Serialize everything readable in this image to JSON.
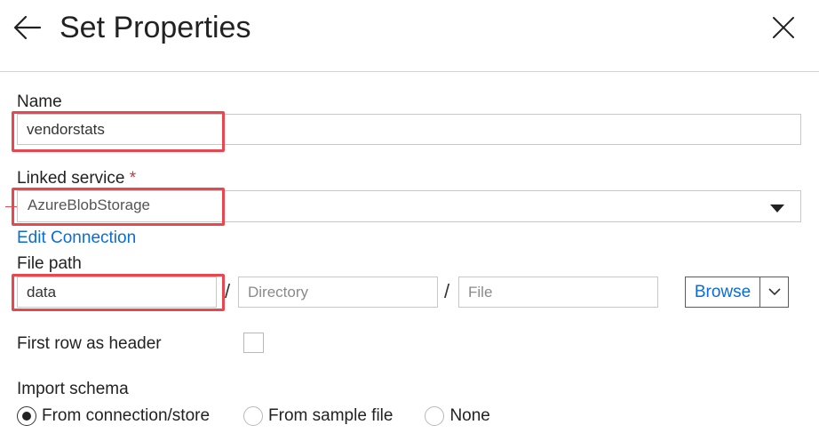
{
  "header": {
    "title": "Set Properties",
    "back_icon": "back-arrow-icon",
    "close_icon": "close-icon"
  },
  "form": {
    "name": {
      "label": "Name",
      "value": "vendorstats"
    },
    "linked_service": {
      "label": "Linked service",
      "required_mark": "*",
      "selected": "AzureBlobStorage",
      "edit_link": "Edit Connection"
    },
    "file_path": {
      "label": "File path",
      "container_value": "data",
      "directory_placeholder": "Directory",
      "file_placeholder": "File",
      "separator": "/",
      "browse_label": "Browse"
    },
    "first_row_header": {
      "label": "First row as header",
      "checked": false
    },
    "import_schema": {
      "label": "Import schema",
      "options": [
        "From connection/store",
        "From sample file",
        "None"
      ],
      "selected_index": 0
    }
  },
  "colors": {
    "accent": "#0a6cd6",
    "highlight": "#e8474f",
    "required": "#d13438"
  }
}
